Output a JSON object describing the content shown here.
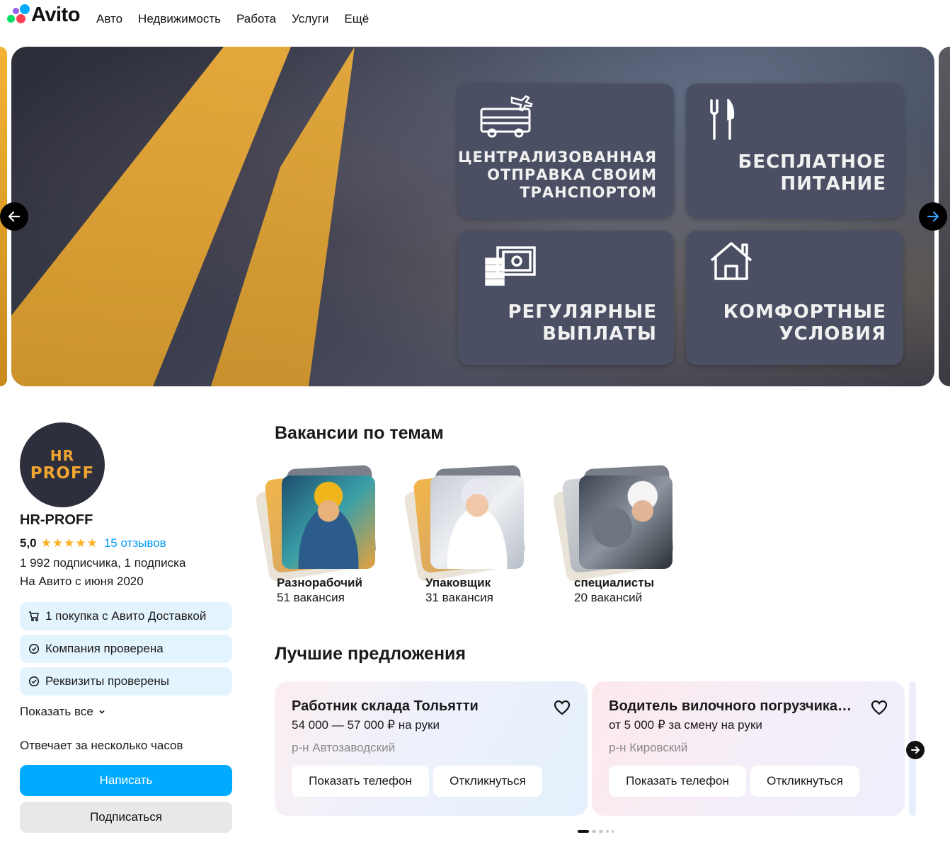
{
  "header": {
    "logo": "Avito",
    "nav": [
      "Авто",
      "Недвижимость",
      "Работа",
      "Услуги",
      "Ещё"
    ]
  },
  "banner": {
    "tiles": [
      {
        "icon": "bus-plane-icon",
        "lines": [
          "ЦЕНТРАЛИЗОВАННАЯ",
          "ОТПРАВКА СВОИМ",
          "ТРАНСПОРТОМ"
        ]
      },
      {
        "icon": "fork-knife-icon",
        "lines": [
          "БЕСПЛАТНОЕ",
          "ПИТАНИЕ"
        ]
      },
      {
        "icon": "money-icon",
        "lines": [
          "РЕГУЛЯРНЫЕ",
          "ВЫПЛАТЫ"
        ]
      },
      {
        "icon": "house-icon",
        "lines": [
          "КОМФОРТНЫЕ",
          "УСЛОВИЯ"
        ]
      }
    ]
  },
  "company": {
    "avatar_line1": "HR",
    "avatar_line2": "PROFF",
    "name": "HR-PROFF",
    "score": "5,0",
    "stars": "★★★★★",
    "reviews": "15 отзывов",
    "subscribers": "1 992 подписчика, 1 подписка",
    "since": "На Авито с июня 2020",
    "badges": [
      {
        "icon": "cart-icon",
        "label": "1 покупка с Авито Доставкой"
      },
      {
        "icon": "check-circle-icon",
        "label": "Компания проверена"
      },
      {
        "icon": "check-circle-icon",
        "label": "Реквизиты проверены"
      }
    ],
    "show_all": "Показать все",
    "answers": "Отвечает за несколько часов",
    "write_button": "Написать",
    "subscribe_button": "Подписаться"
  },
  "themes": {
    "title": "Вакансии по темам",
    "items": [
      {
        "title": "Разнорабочий",
        "count": "51 вакансия"
      },
      {
        "title": "Упаковщик",
        "count": "31 вакансия"
      },
      {
        "title": "специалисты",
        "count": "20 вакансий"
      }
    ]
  },
  "offers": {
    "title": "Лучшие предложения",
    "items": [
      {
        "title": "Работник склада Тольятти",
        "salary": "54 000 — 57 000 ₽ на руки",
        "district": "р-н Автозаводский",
        "phone_button": "Показать телефон",
        "respond_button": "Откликнуться"
      },
      {
        "title": "Водитель вилочного погрузчика…",
        "salary": "от 5 000 ₽ за смену на руки",
        "district": "р-н Кировский",
        "phone_button": "Показать телефон",
        "respond_button": "Откликнуться"
      }
    ]
  },
  "colors": {
    "accent": "#00aaff",
    "link": "#0099f7",
    "star": "#ffb021",
    "badge_bg": "#e4f4fe"
  }
}
